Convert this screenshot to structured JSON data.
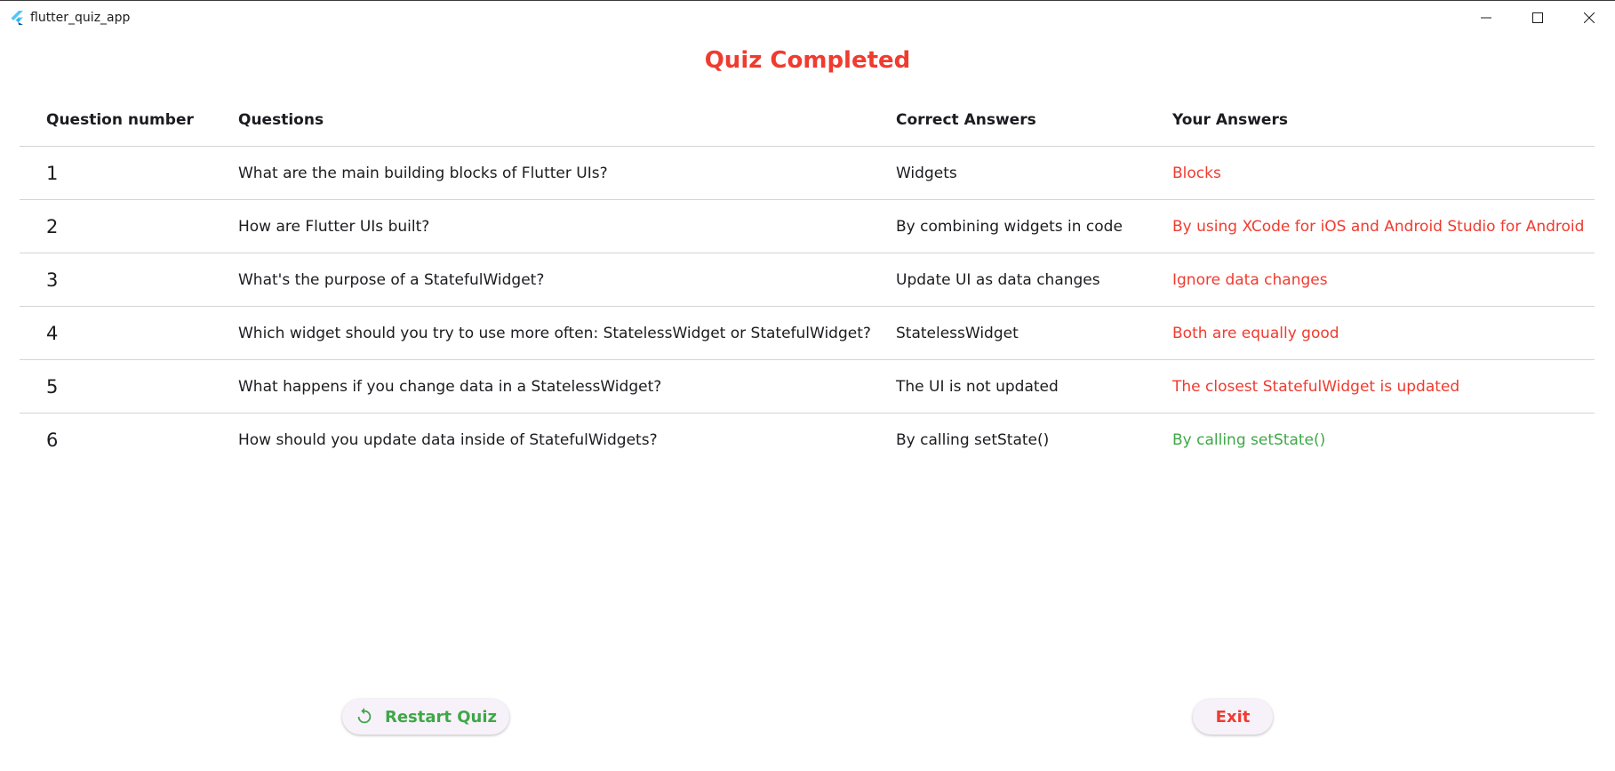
{
  "window": {
    "title": "flutter_quiz_app",
    "controls": [
      "minimize-icon",
      "maximize-icon",
      "close-icon"
    ]
  },
  "heading": "Quiz Completed",
  "table": {
    "headers": [
      "Question number",
      "Questions",
      "Correct Answers",
      "Your Answers"
    ],
    "rows": [
      {
        "number": "1",
        "question": "What are the main building blocks of Flutter UIs?",
        "correct": "Widgets",
        "yours": "Blocks",
        "is_correct": false
      },
      {
        "number": "2",
        "question": "How are Flutter UIs built?",
        "correct": "By combining widgets in code",
        "yours": "By using XCode for iOS and Android Studio for Android",
        "is_correct": false
      },
      {
        "number": "3",
        "question": "What's the purpose of a StatefulWidget?",
        "correct": "Update UI as data changes",
        "yours": "Ignore data changes",
        "is_correct": false
      },
      {
        "number": "4",
        "question": "Which widget should you try to use more often: StatelessWidget or StatefulWidget?",
        "correct": "StatelessWidget",
        "yours": "Both are equally good",
        "is_correct": false
      },
      {
        "number": "5",
        "question": "What happens if you change data in a StatelessWidget?",
        "correct": "The UI is not updated",
        "yours": "The closest StatefulWidget is updated",
        "is_correct": false
      },
      {
        "number": "6",
        "question": "How should you update data inside of StatefulWidgets?",
        "correct": "By calling setState()",
        "yours": "By calling setState()",
        "is_correct": true
      }
    ]
  },
  "buttons": {
    "restart_label": "Restart Quiz",
    "restart_icon": "restart-icon",
    "exit_label": "Exit"
  },
  "colors": {
    "accent_red": "#f03b2f",
    "accent_green": "#3fa847",
    "button_bg": "#f7f2fa",
    "divider": "#d4d4d4"
  }
}
